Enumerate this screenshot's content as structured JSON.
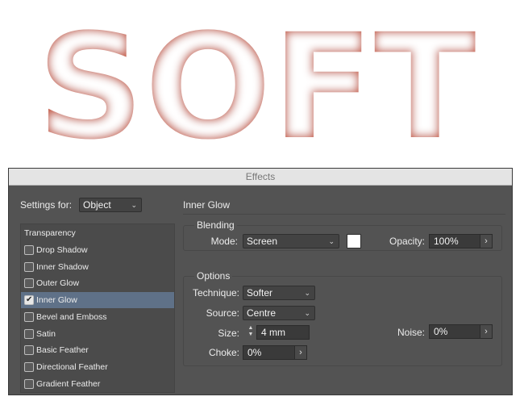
{
  "banner": {
    "text": "SOFT",
    "glow_color": "#c86048"
  },
  "dialog": {
    "title": "Effects",
    "settings_for_label": "Settings for:",
    "settings_for_value": "Object",
    "section_title": "Inner Glow",
    "effects_list": {
      "heading": "Transparency",
      "items": [
        {
          "label": "Drop Shadow",
          "checked": false,
          "selected": false
        },
        {
          "label": "Inner Shadow",
          "checked": false,
          "selected": false
        },
        {
          "label": "Outer Glow",
          "checked": false,
          "selected": false
        },
        {
          "label": "Inner Glow",
          "checked": true,
          "selected": true
        },
        {
          "label": "Bevel and Emboss",
          "checked": false,
          "selected": false
        },
        {
          "label": "Satin",
          "checked": false,
          "selected": false
        },
        {
          "label": "Basic Feather",
          "checked": false,
          "selected": false
        },
        {
          "label": "Directional Feather",
          "checked": false,
          "selected": false
        },
        {
          "label": "Gradient Feather",
          "checked": false,
          "selected": false
        }
      ]
    },
    "blending": {
      "title": "Blending",
      "mode_label": "Mode:",
      "mode_value": "Screen",
      "color_swatch": "#ffffff",
      "opacity_label": "Opacity:",
      "opacity_value": "100%"
    },
    "options": {
      "title": "Options",
      "technique_label": "Technique:",
      "technique_value": "Softer",
      "source_label": "Source:",
      "source_value": "Centre",
      "size_label": "Size:",
      "size_value": "4 mm",
      "choke_label": "Choke:",
      "choke_value": "0%",
      "noise_label": "Noise:",
      "noise_value": "0%"
    }
  }
}
